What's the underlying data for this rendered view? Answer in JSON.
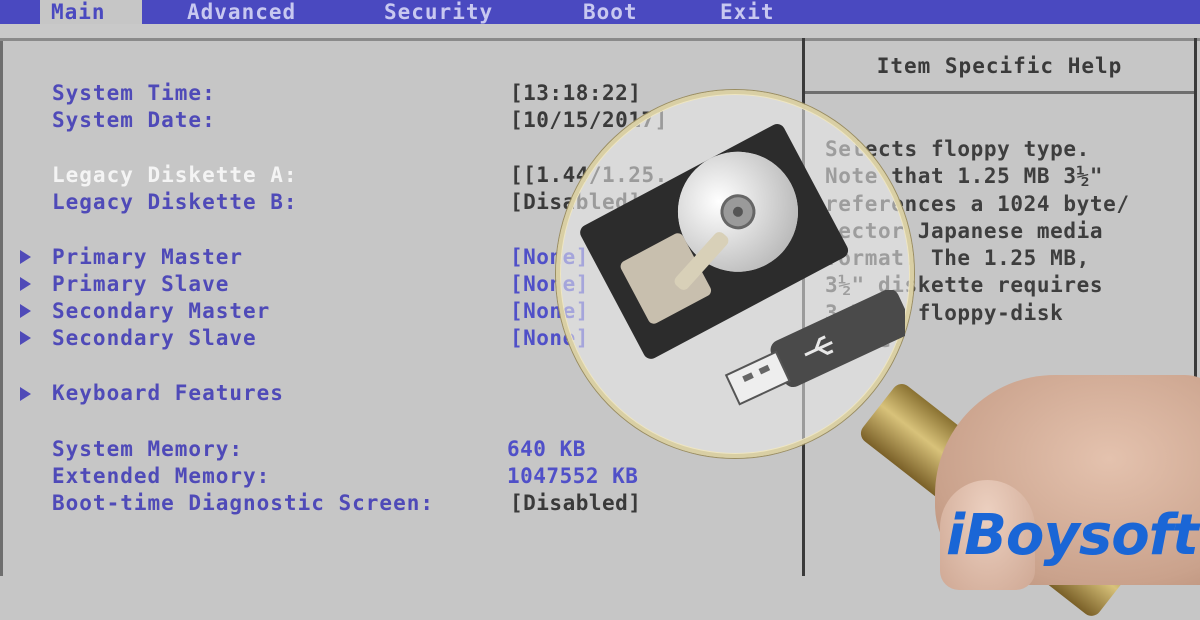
{
  "menubar": {
    "items": [
      {
        "label": "Main",
        "active": true
      },
      {
        "label": "Advanced",
        "active": false
      },
      {
        "label": "Security",
        "active": false
      },
      {
        "label": "Boot",
        "active": false
      },
      {
        "label": "Exit",
        "active": false
      }
    ]
  },
  "settings": {
    "system_time": {
      "label": "System Time:",
      "value": "[13:18:22]"
    },
    "system_date": {
      "label": "System Date:",
      "value": "[10/15/2017]"
    },
    "legacy_a": {
      "label": "Legacy Diskette A:",
      "value": "[1.44/1.25 MB 3½\"]",
      "visible_value": "[1.44/1.25."
    },
    "legacy_b": {
      "label": "Legacy Diskette B:",
      "value": "[Disabled]"
    },
    "submenus": [
      {
        "label": "Primary Master",
        "value": "[None]"
      },
      {
        "label": "Primary Slave",
        "value": "[None]"
      },
      {
        "label": "Secondary Master",
        "value": "[None]"
      },
      {
        "label": "Secondary Slave",
        "value": "[None]"
      }
    ],
    "keyboard": {
      "label": "Keyboard Features"
    },
    "system_memory": {
      "label": "System Memory:",
      "value": "640 KB"
    },
    "extended_memory": {
      "label": "Extended Memory:",
      "value": "1047552 KB"
    },
    "boot_diag": {
      "label": "Boot-time Diagnostic Screen:",
      "value": "[Disabled]"
    }
  },
  "help": {
    "title": "Item Specific Help",
    "body": "Selects floppy type.\nNote that 1.25 MB 3½\"\nreferences a 1024 byte/\nsector Japanese media\nformat. The 1.25 MB,\n3½\" diskette requires\n3-Mode floppy-disk\ndrive."
  },
  "overlay": {
    "brand": "iBoysoft",
    "brand_color": "#1a66d6",
    "icons": [
      "magnifying-glass",
      "hard-drive",
      "usb-flash-drive"
    ]
  }
}
